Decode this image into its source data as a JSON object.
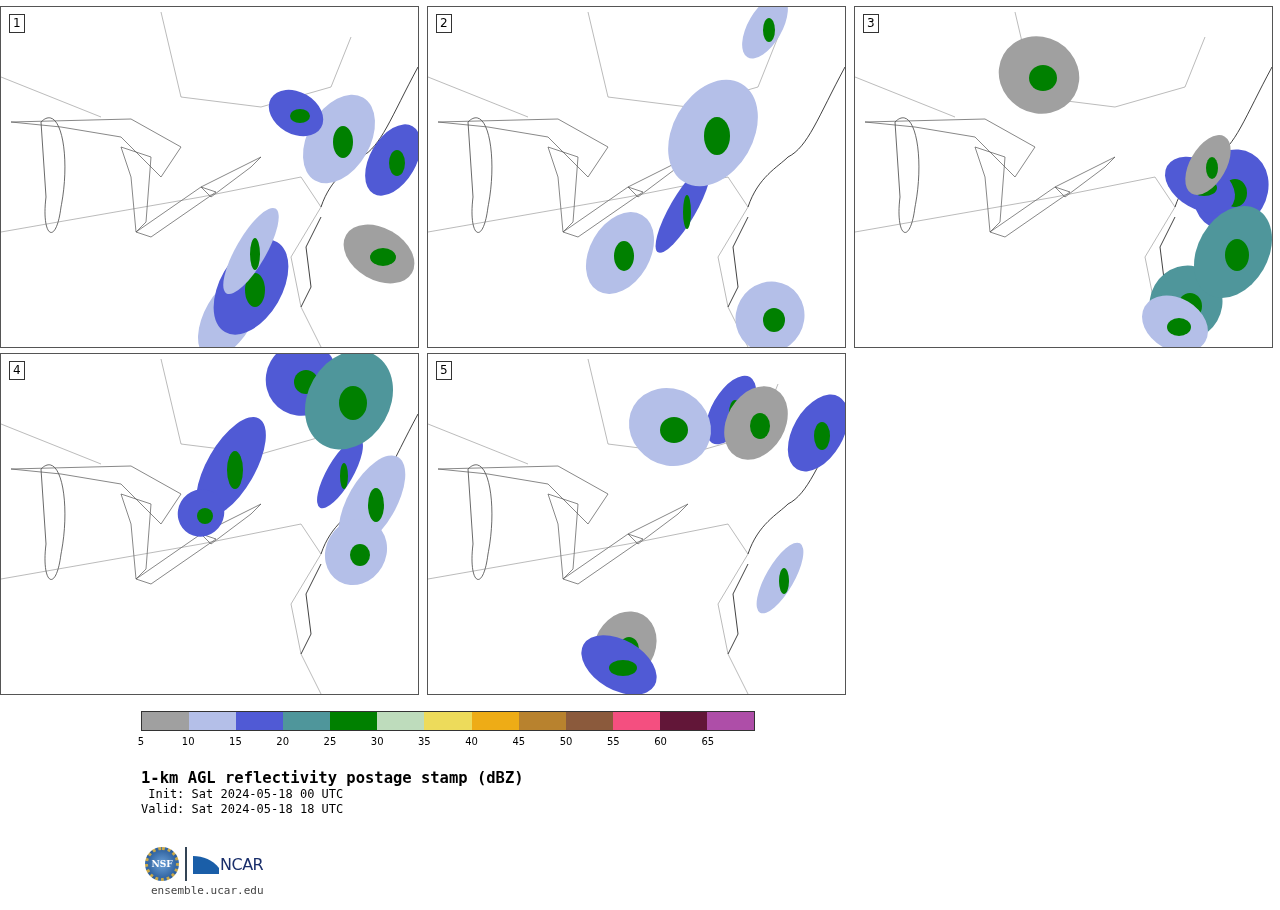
{
  "panels": [
    {
      "number": "1"
    },
    {
      "number": "2"
    },
    {
      "number": "3"
    },
    {
      "number": "4"
    },
    {
      "number": "5"
    }
  ],
  "colorbar": {
    "bins": [
      {
        "color": "#a0a0a0"
      },
      {
        "color": "#b4bfe8"
      },
      {
        "color": "#505ad5"
      },
      {
        "color": "#4f969b"
      },
      {
        "color": "#008000"
      },
      {
        "color": "#bedcbc"
      },
      {
        "color": "#eddb5b"
      },
      {
        "color": "#eeac16"
      },
      {
        "color": "#b8822e"
      },
      {
        "color": "#8b5a3c"
      },
      {
        "color": "#f44f80"
      },
      {
        "color": "#621638"
      },
      {
        "color": "#ae4ea8"
      }
    ],
    "ticks": [
      "5",
      "10",
      "15",
      "20",
      "25",
      "30",
      "35",
      "40",
      "45",
      "50",
      "55",
      "60",
      "65"
    ]
  },
  "title": "1-km AGL reflectivity postage stamp (dBZ)",
  "init": " Init: Sat 2024-05-18 00 UTC",
  "valid": "Valid: Sat 2024-05-18 18 UTC",
  "logos": {
    "seal": "NSF",
    "wordmark": "NCAR"
  },
  "url": "ensemble.ucar.edu"
}
